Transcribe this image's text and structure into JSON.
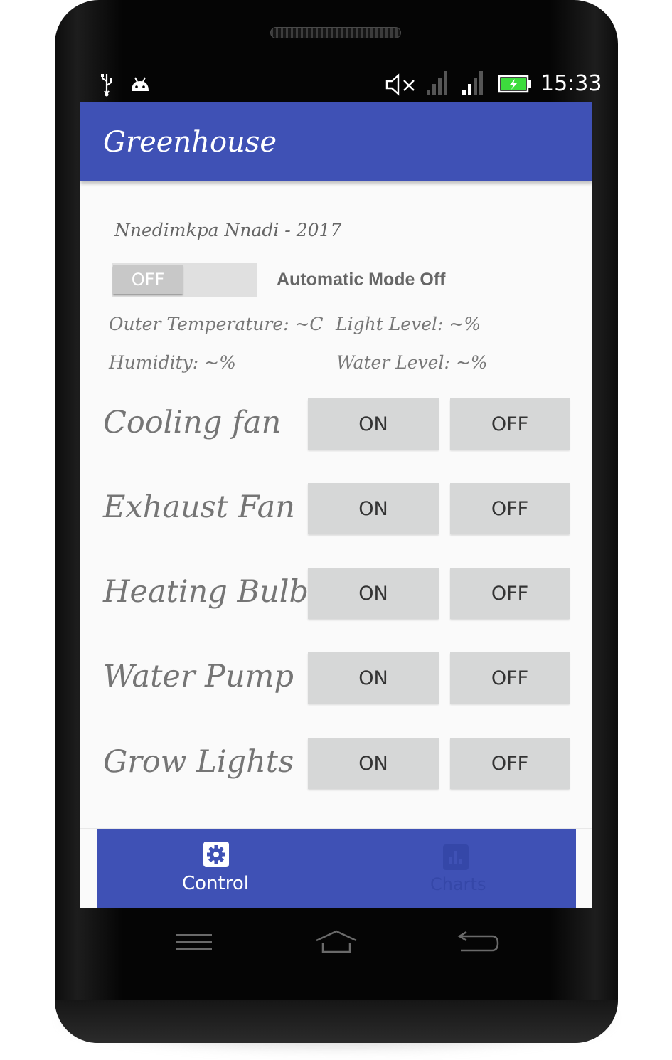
{
  "status_bar": {
    "time": "15:33",
    "icons": [
      "usb-icon",
      "android-debug-icon",
      "volume-muted-icon",
      "signal-icon",
      "signal-icon",
      "battery-charging-icon"
    ]
  },
  "app_bar": {
    "title": "Greenhouse"
  },
  "author_line": "Nnedimkpa Nnadi - 2017",
  "auto_mode": {
    "toggle_label": "OFF",
    "status_text": "Automatic Mode Off"
  },
  "sensors": {
    "outer_temperature": "Outer Temperature: ~C",
    "light_level": "Light Level: ~%",
    "humidity": "Humidity: ~%",
    "water_level": "Water Level: ~%"
  },
  "devices": [
    {
      "name": "Cooling fan",
      "on_label": "ON",
      "off_label": "OFF"
    },
    {
      "name": "Exhaust Fan",
      "on_label": "ON",
      "off_label": "OFF"
    },
    {
      "name": "Heating Bulb",
      "on_label": "ON",
      "off_label": "OFF"
    },
    {
      "name": "Water Pump",
      "on_label": "ON",
      "off_label": "OFF"
    },
    {
      "name": "Grow Lights",
      "on_label": "ON",
      "off_label": "OFF"
    }
  ],
  "bottom_nav": {
    "tabs": [
      {
        "label": "Control",
        "icon": "gear-icon",
        "active": true
      },
      {
        "label": "Charts",
        "icon": "bar-chart-icon",
        "active": false
      }
    ]
  },
  "nav_keys": [
    "menu-key-icon",
    "home-key-icon",
    "back-key-icon"
  ],
  "colors": {
    "primary": "#3f51b5",
    "button_bg": "#d6d7d7",
    "screen_bg": "#fafafa"
  }
}
